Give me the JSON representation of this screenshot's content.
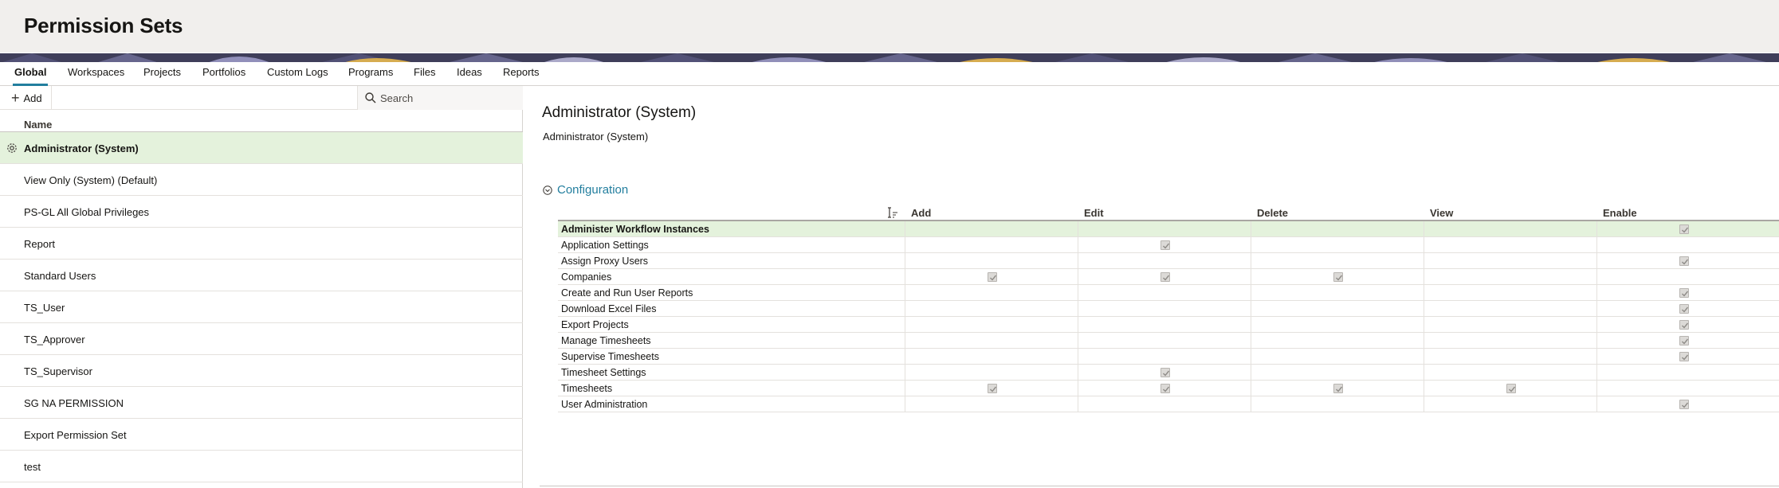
{
  "header": {
    "title": "Permission Sets"
  },
  "tabs": [
    {
      "label": "Global",
      "active": true
    },
    {
      "label": "Workspaces"
    },
    {
      "label": "Projects"
    },
    {
      "label": "Portfolios"
    },
    {
      "label": "Custom Logs"
    },
    {
      "label": "Programs"
    },
    {
      "label": "Files"
    },
    {
      "label": "Ideas"
    },
    {
      "label": "Reports"
    }
  ],
  "toolbar": {
    "add_label": "Add",
    "search_placeholder": "Search"
  },
  "list": {
    "column_header": "Name",
    "items": [
      {
        "label": "Administrator (System)",
        "selected": true
      },
      {
        "label": "View Only (System) (Default)"
      },
      {
        "label": "PS-GL All Global Privileges"
      },
      {
        "label": "Report"
      },
      {
        "label": "Standard Users"
      },
      {
        "label": "TS_User"
      },
      {
        "label": "TS_Approver"
      },
      {
        "label": "TS_Supervisor"
      },
      {
        "label": "SG NA PERMISSION"
      },
      {
        "label": "Export Permission Set"
      },
      {
        "label": "test"
      }
    ]
  },
  "detail": {
    "title": "Administrator (System)",
    "subtitle": "Administrator (System)",
    "section_label": "Configuration",
    "columns": [
      "Add",
      "Edit",
      "Delete",
      "View",
      "Enable"
    ],
    "rows": [
      {
        "name": "Administer Workflow Instances",
        "checks": [
          false,
          false,
          false,
          false,
          true
        ],
        "selected": true
      },
      {
        "name": "Application Settings",
        "checks": [
          false,
          true,
          false,
          false,
          false
        ]
      },
      {
        "name": "Assign Proxy Users",
        "checks": [
          false,
          false,
          false,
          false,
          true
        ]
      },
      {
        "name": "Companies",
        "checks": [
          true,
          true,
          true,
          false,
          false
        ]
      },
      {
        "name": "Create and Run User Reports",
        "checks": [
          false,
          false,
          false,
          false,
          true
        ]
      },
      {
        "name": "Download Excel Files",
        "checks": [
          false,
          false,
          false,
          false,
          true
        ]
      },
      {
        "name": "Export Projects",
        "checks": [
          false,
          false,
          false,
          false,
          true
        ]
      },
      {
        "name": "Manage Timesheets",
        "checks": [
          false,
          false,
          false,
          false,
          true
        ]
      },
      {
        "name": "Supervise Timesheets",
        "checks": [
          false,
          false,
          false,
          false,
          true
        ]
      },
      {
        "name": "Timesheet Settings",
        "checks": [
          false,
          true,
          false,
          false,
          false
        ]
      },
      {
        "name": "Timesheets",
        "checks": [
          true,
          true,
          true,
          true,
          false
        ]
      },
      {
        "name": "User Administration",
        "checks": [
          false,
          false,
          false,
          false,
          true
        ]
      }
    ]
  },
  "colors": {
    "accent": "#227e9e",
    "selected_row": "#e4f2dc",
    "header_bg": "#f1efed"
  }
}
